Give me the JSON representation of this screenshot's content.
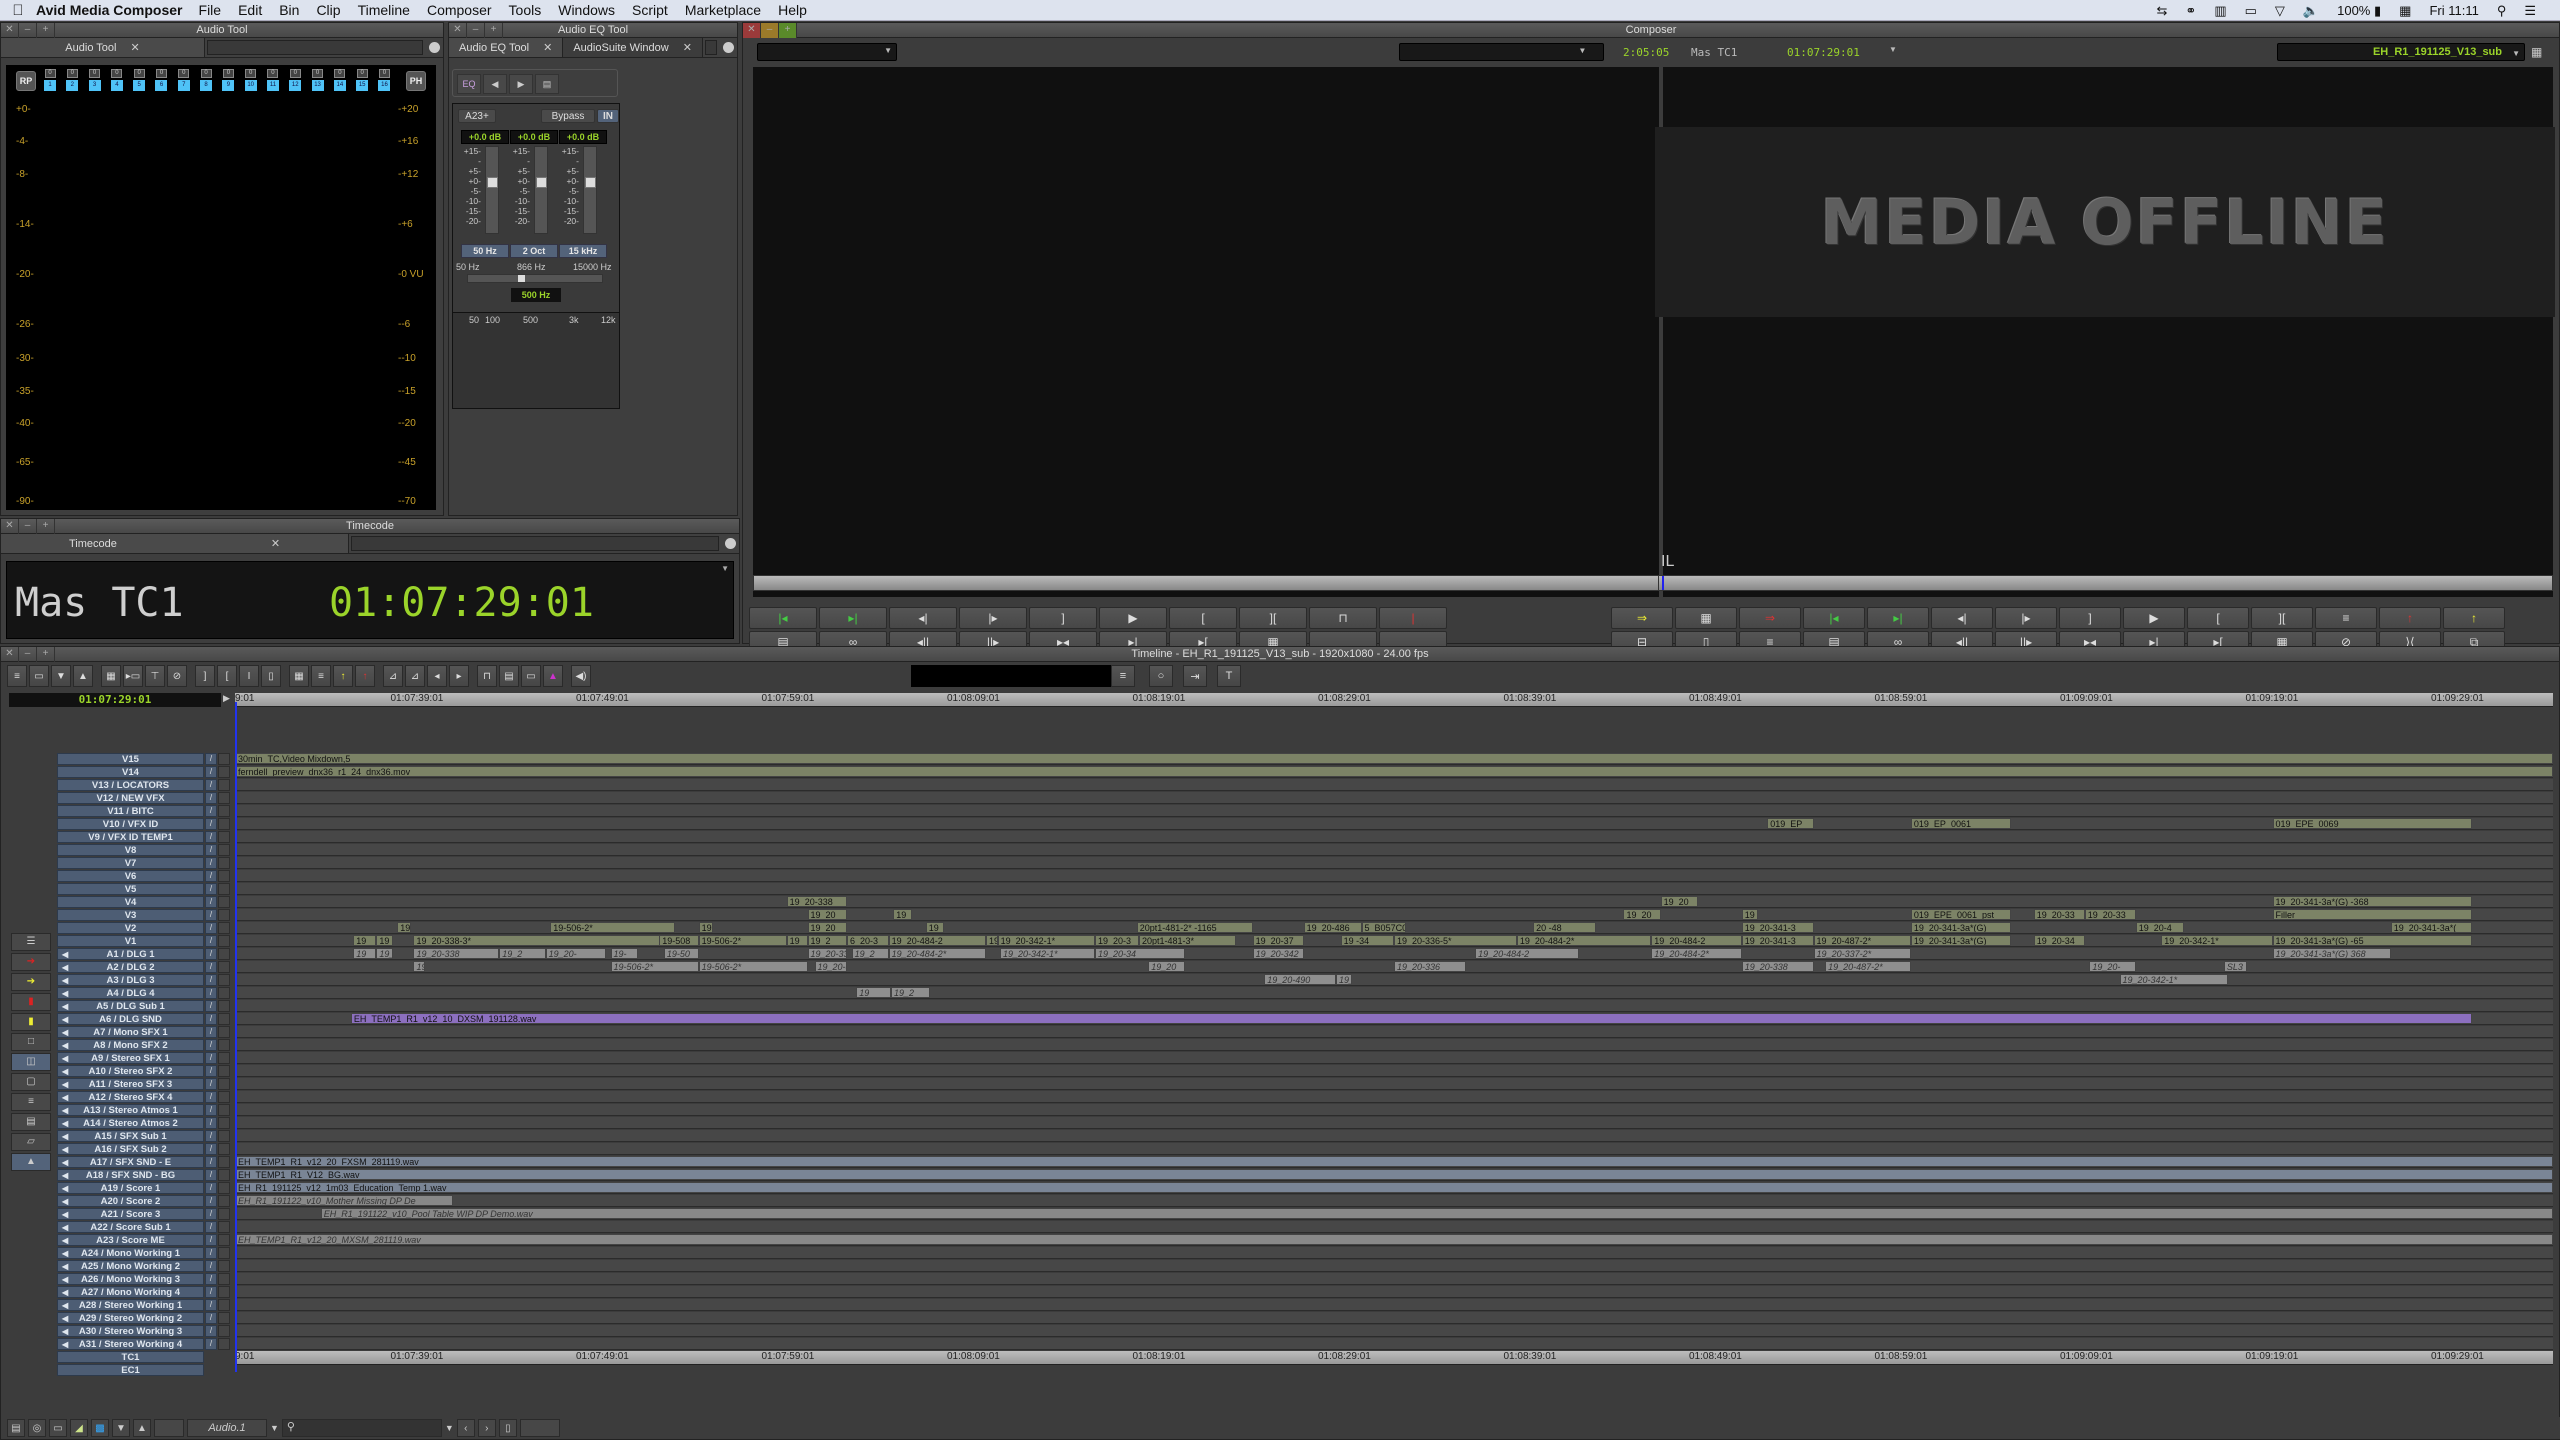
{
  "menubar": {
    "app_name": "Avid Media Composer",
    "items": [
      "File",
      "Edit",
      "Bin",
      "Clip",
      "Timeline",
      "Composer",
      "Tools",
      "Windows",
      "Script",
      "Marketplace",
      "Help"
    ],
    "status": {
      "battery": "100%",
      "clock": "Fri 11:11"
    }
  },
  "audio_tool": {
    "window_title": "Audio Tool",
    "tab_label": "Audio Tool",
    "rp_label": "RP",
    "ph_label": "PH",
    "channels": [
      "1",
      "2",
      "3",
      "4",
      "5",
      "6",
      "7",
      "8",
      "9",
      "10",
      "11",
      "12",
      "13",
      "14",
      "15",
      "16"
    ],
    "channel_peak": "0",
    "left_scale": [
      "+0-",
      "-4-",
      "-8-",
      "-14-",
      "-20-",
      "-26-",
      "-30-",
      "-35-",
      "-40-",
      "-65-",
      "-90-"
    ],
    "right_scale": [
      "-+20",
      "-+16",
      "-+12",
      "-+6",
      "-0 VU",
      "--6",
      "--10",
      "--15",
      "--20",
      "--45",
      "--70"
    ]
  },
  "eq_tool": {
    "window_title": "Audio EQ Tool",
    "tabs": [
      "Audio EQ Tool",
      "AudioSuite Window"
    ],
    "eq_icon_label": "EQ",
    "track_button": "A23+",
    "bypass_label": "Bypass",
    "in_label": "IN",
    "band_gains": [
      "+0.0 dB",
      "+0.0 dB",
      "+0.0 dB"
    ],
    "fader_scale": [
      "+15-",
      "-",
      "+5-",
      "+0-",
      "-5-",
      "-10-",
      "-15-",
      "-20-"
    ],
    "band_buttons": [
      "50 Hz",
      "2 Oct",
      "15 kHz"
    ],
    "freq_range": [
      "50 Hz",
      "866 Hz",
      "15000 Hz"
    ],
    "mid_freq": "500 Hz",
    "graph_labels": [
      "50",
      "100",
      "500",
      "3k",
      "12k"
    ]
  },
  "timecode_window": {
    "window_title": "Timecode",
    "tab_label": "Timecode",
    "label": "Mas TC1",
    "value": "01:07:29:01"
  },
  "composer": {
    "window_title": "Composer",
    "duration": "2:05:05",
    "tc_label": "Mas TC1",
    "tc_value": "01:07:29:01",
    "sequence_name": "EH_R1_191125_V13_sub",
    "offline_text": "MEDIA OFFLINE",
    "overlay_text": "IL"
  },
  "timeline": {
    "title": "Timeline - EH_R1_191125_V13_sub - 1920x1080 - 24.00 fps",
    "current_tc": "01:07:29:01",
    "ruler_ticks": [
      "9:01",
      "01:07:39:01",
      "01:07:49:01",
      "01:07:59:01",
      "01:08:09:01",
      "01:08:19:01",
      "01:08:29:01",
      "01:08:39:01",
      "01:08:49:01",
      "01:08:59:01",
      "01:09:09:01",
      "01:09:19:01",
      "01:09:29:01"
    ],
    "tracks": [
      {
        "name": "V15",
        "clips": [
          {
            "label": "30min_TC,Video Mixdown,5",
            "start": 0,
            "end": 1,
            "type": "v"
          }
        ]
      },
      {
        "name": "V14",
        "clips": [
          {
            "label": "ferndell_preview_dnx36_r1_24_dnx36.mov",
            "start": 0,
            "end": 1,
            "type": "v"
          }
        ]
      },
      {
        "name": "V13 / LOCATORS",
        "clips": []
      },
      {
        "name": "V12 / NEW VFX",
        "clips": []
      },
      {
        "name": "V11 / BITC",
        "clips": []
      },
      {
        "name": "V10 / VFX ID",
        "clips": [
          {
            "label": "019_EP",
            "start": 0.661,
            "end": 0.681,
            "type": "v"
          },
          {
            "label": "019_EP_0061",
            "start": 0.723,
            "end": 0.766,
            "type": "v"
          },
          {
            "label": "019_EPE_0069",
            "start": 0.879,
            "end": 0.965,
            "type": "v"
          }
        ]
      },
      {
        "name": "V9 / VFX ID TEMP1",
        "clips": []
      },
      {
        "name": "V8",
        "clips": []
      },
      {
        "name": "V7",
        "clips": []
      },
      {
        "name": "V6",
        "clips": []
      },
      {
        "name": "V5",
        "clips": []
      },
      {
        "name": "V4",
        "clips": [
          {
            "label": "19_20-338",
            "start": 0.238,
            "end": 0.264,
            "type": "v"
          },
          {
            "label": "19_20",
            "start": 0.615,
            "end": 0.631,
            "type": "v"
          },
          {
            "label": "19_20-341-3a*(G)  -368",
            "start": 0.879,
            "end": 0.965,
            "type": "v"
          }
        ]
      },
      {
        "name": "V3",
        "clips": [
          {
            "label": "19_20",
            "start": 0.247,
            "end": 0.264,
            "type": "v"
          },
          {
            "label": "19",
            "start": 0.284,
            "end": 0.292,
            "type": "v"
          },
          {
            "label": "19_20",
            "start": 0.599,
            "end": 0.615,
            "type": "v"
          },
          {
            "label": "19_",
            "start": 0.65,
            "end": 0.657,
            "type": "v"
          },
          {
            "label": "019_EPE_0061_pst",
            "start": 0.723,
            "end": 0.766,
            "type": "v"
          },
          {
            "label": "19_20-33",
            "start": 0.776,
            "end": 0.798,
            "type": "v"
          },
          {
            "label": "19_20-33",
            "start": 0.798,
            "end": 0.82,
            "type": "v"
          },
          {
            "label": "Filler",
            "start": 0.879,
            "end": 0.965,
            "type": "v"
          }
        ]
      },
      {
        "name": "V2",
        "clips": [
          {
            "label": "19",
            "start": 0.07,
            "end": 0.076,
            "type": "v"
          },
          {
            "label": "19-506-2*",
            "start": 0.136,
            "end": 0.19,
            "type": "v"
          },
          {
            "label": "19",
            "start": 0.2,
            "end": 0.206,
            "type": "v"
          },
          {
            "label": "19_20",
            "start": 0.247,
            "end": 0.264,
            "type": "v"
          },
          {
            "label": "19",
            "start": 0.298,
            "end": 0.306,
            "type": "v"
          },
          {
            "label": "20pt1-481-2*  -1165",
            "start": 0.389,
            "end": 0.439,
            "type": "v"
          },
          {
            "label": "19_20-486",
            "start": 0.461,
            "end": 0.486,
            "type": "v"
          },
          {
            "label": "5_B057C0",
            "start": 0.486,
            "end": 0.505,
            "type": "v"
          },
          {
            "label": "20  -48",
            "start": 0.56,
            "end": 0.587,
            "type": "v"
          },
          {
            "label": "19_20-341-3",
            "start": 0.65,
            "end": 0.681,
            "type": "v"
          },
          {
            "label": "19_20-341-3a*(G)",
            "start": 0.723,
            "end": 0.766,
            "type": "v"
          },
          {
            "label": "19_20-4",
            "start": 0.82,
            "end": 0.841,
            "type": "v"
          },
          {
            "label": "19_20-341-3a*(",
            "start": 0.93,
            "end": 0.965,
            "type": "v"
          }
        ]
      },
      {
        "name": "V1",
        "clips": [
          {
            "label": "19",
            "start": 0.051,
            "end": 0.061,
            "type": "v"
          },
          {
            "label": "19",
            "start": 0.061,
            "end": 0.068,
            "type": "v"
          },
          {
            "label": "19_20-338-3*",
            "start": 0.077,
            "end": 0.191,
            "type": "v"
          },
          {
            "label": "19-508",
            "start": 0.183,
            "end": 0.2,
            "type": "v"
          },
          {
            "label": "19-506-2*",
            "start": 0.2,
            "end": 0.238,
            "type": "v"
          },
          {
            "label": "19_",
            "start": 0.238,
            "end": 0.247,
            "type": "v"
          },
          {
            "label": "19_2",
            "start": 0.247,
            "end": 0.264,
            "type": "v"
          },
          {
            "label": "6_20-3",
            "start": 0.264,
            "end": 0.282,
            "type": "v"
          },
          {
            "label": "19_20-484-2",
            "start": 0.282,
            "end": 0.324,
            "type": "v"
          },
          {
            "label": "19",
            "start": 0.324,
            "end": 0.329,
            "type": "v"
          },
          {
            "label": "19_20-342-1*",
            "start": 0.329,
            "end": 0.371,
            "type": "v"
          },
          {
            "label": "19_20-3",
            "start": 0.371,
            "end": 0.39,
            "type": "v"
          },
          {
            "label": "20pt1-481-3*",
            "start": 0.39,
            "end": 0.432,
            "type": "v"
          },
          {
            "label": "19_20-37",
            "start": 0.439,
            "end": 0.461,
            "type": "v"
          },
          {
            "label": "19  -34",
            "start": 0.477,
            "end": 0.5,
            "type": "v"
          },
          {
            "label": "19_20-336-5*",
            "start": 0.5,
            "end": 0.553,
            "type": "v"
          },
          {
            "label": "19_20-484-2*",
            "start": 0.553,
            "end": 0.611,
            "type": "v"
          },
          {
            "label": "19_20-484-2",
            "start": 0.611,
            "end": 0.65,
            "type": "v"
          },
          {
            "label": "19_20-341-3",
            "start": 0.65,
            "end": 0.681,
            "type": "v"
          },
          {
            "label": "19_20-487-2*",
            "start": 0.681,
            "end": 0.723,
            "type": "v"
          },
          {
            "label": "19_20-341-3a*(G)",
            "start": 0.723,
            "end": 0.766,
            "type": "v"
          },
          {
            "label": "19_20-34",
            "start": 0.776,
            "end": 0.798,
            "type": "v"
          },
          {
            "label": "19_20-342-1*",
            "start": 0.831,
            "end": 0.879,
            "type": "v"
          },
          {
            "label": "19_20-341-3a*(G)  -65",
            "start": 0.879,
            "end": 0.965,
            "type": "v"
          }
        ]
      },
      {
        "name": "A1 / DLG 1",
        "clips": [
          {
            "label": "19",
            "start": 0.051,
            "end": 0.061,
            "type": "a"
          },
          {
            "label": "19_",
            "start": 0.061,
            "end": 0.068,
            "type": "a"
          },
          {
            "label": "19_20-338",
            "start": 0.077,
            "end": 0.114,
            "type": "a"
          },
          {
            "label": "19_2",
            "start": 0.114,
            "end": 0.134,
            "type": "a"
          },
          {
            "label": "19_20-",
            "start": 0.134,
            "end": 0.16,
            "type": "a"
          },
          {
            "label": "19-",
            "start": 0.162,
            "end": 0.174,
            "type": "a"
          },
          {
            "label": "19-50",
            "start": 0.185,
            "end": 0.2,
            "type": "a"
          },
          {
            "label": "19_20-33",
            "start": 0.247,
            "end": 0.264,
            "type": "a"
          },
          {
            "label": "19_2",
            "start": 0.266,
            "end": 0.282,
            "type": "a"
          },
          {
            "label": "19_20-484-2*",
            "start": 0.282,
            "end": 0.324,
            "type": "a"
          },
          {
            "label": "19_20-342-1*",
            "start": 0.33,
            "end": 0.371,
            "type": "a"
          },
          {
            "label": "19_20-34",
            "start": 0.371,
            "end": 0.41,
            "type": "a"
          },
          {
            "label": "19_20-342",
            "start": 0.439,
            "end": 0.461,
            "type": "a"
          },
          {
            "label": "19_20-484-2",
            "start": 0.535,
            "end": 0.58,
            "type": "a"
          },
          {
            "label": "19_20-484-2*",
            "start": 0.611,
            "end": 0.65,
            "type": "a"
          },
          {
            "label": "19_20-337-2*",
            "start": 0.681,
            "end": 0.723,
            "type": "a"
          },
          {
            "label": "19_20-341-3a*(G)  368",
            "start": 0.879,
            "end": 0.93,
            "type": "a"
          }
        ]
      },
      {
        "name": "A2 / DLG 2",
        "clips": [
          {
            "label": "19",
            "start": 0.077,
            "end": 0.082,
            "type": "a"
          },
          {
            "label": "19-506-2*",
            "start": 0.162,
            "end": 0.2,
            "type": "a"
          },
          {
            "label": "19-506-2*",
            "start": 0.2,
            "end": 0.247,
            "type": "a"
          },
          {
            "label": "19_20-3",
            "start": 0.25,
            "end": 0.264,
            "type": "a"
          },
          {
            "label": "19_20",
            "start": 0.394,
            "end": 0.41,
            "type": "a"
          },
          {
            "label": "19_20-336",
            "start": 0.5,
            "end": 0.531,
            "type": "a"
          },
          {
            "label": "19_20-338",
            "start": 0.65,
            "end": 0.681,
            "type": "a"
          },
          {
            "label": "19_20-487-2*",
            "start": 0.686,
            "end": 0.723,
            "type": "a"
          },
          {
            "label": "19_20-",
            "start": 0.8,
            "end": 0.82,
            "type": "a"
          },
          {
            "label": "SL3",
            "start": 0.858,
            "end": 0.868,
            "type": "a"
          }
        ]
      },
      {
        "name": "A3 / DLG 3",
        "clips": [
          {
            "label": "19_20-490",
            "start": 0.444,
            "end": 0.475,
            "type": "a"
          },
          {
            "label": "19_",
            "start": 0.475,
            "end": 0.482,
            "type": "a"
          },
          {
            "label": "19_20-342-1*",
            "start": 0.813,
            "end": 0.86,
            "type": "a"
          }
        ]
      },
      {
        "name": "A4 / DLG 4",
        "clips": [
          {
            "label": "19",
            "start": 0.268,
            "end": 0.283,
            "type": "a"
          },
          {
            "label": "19_2",
            "start": 0.283,
            "end": 0.3,
            "type": "a"
          }
        ]
      },
      {
        "name": "A5 / DLG Sub 1",
        "clips": []
      },
      {
        "name": "A6 / DLG SND",
        "clips": [
          {
            "label": "EH_TEMP1_R1_v12_10_DXSM_191128.wav",
            "start": 0.05,
            "end": 0.965,
            "type": "p"
          }
        ]
      },
      {
        "name": "A7 / Mono SFX 1",
        "clips": []
      },
      {
        "name": "A8 / Mono SFX 2",
        "clips": []
      },
      {
        "name": "A9 / Stereo SFX 1",
        "clips": []
      },
      {
        "name": "A10 / Stereo SFX 2",
        "clips": []
      },
      {
        "name": "A11 / Stereo SFX 3",
        "clips": []
      },
      {
        "name": "A12 / Stereo SFX 4",
        "clips": []
      },
      {
        "name": "A13 / Stereo Atmos 1",
        "clips": []
      },
      {
        "name": "A14 / Stereo Atmos 2",
        "clips": []
      },
      {
        "name": "A15 / SFX Sub 1",
        "clips": []
      },
      {
        "name": "A16 / SFX Sub 2",
        "clips": []
      },
      {
        "name": "A17 / SFX SND - E",
        "clips": [
          {
            "label": "EH_TEMP1_R1_v12_20_FXSM_281119.wav",
            "start": 0,
            "end": 1,
            "type": "b"
          }
        ]
      },
      {
        "name": "A18 / SFX SND - BG",
        "clips": [
          {
            "label": "EH_TEMP1_R1_V12_BG.wav",
            "start": 0,
            "end": 1,
            "type": "b"
          }
        ]
      },
      {
        "name": "A19 / Score 1",
        "clips": [
          {
            "label": "EH_R1_191125_v12_1m03_Education_Temp 1.wav",
            "start": 0,
            "end": 1,
            "type": "b"
          }
        ]
      },
      {
        "name": "A20 / Score 2",
        "clips": [
          {
            "label": "EH_R1_191122_v10_Mother Missing DP De",
            "start": 0,
            "end": 0.094,
            "type": "g"
          }
        ]
      },
      {
        "name": "A21 / Score 3",
        "clips": [
          {
            "label": "EH_R1_191122_v10_Pool Table WIP DP Demo.wav",
            "start": 0.037,
            "end": 1,
            "type": "g"
          }
        ]
      },
      {
        "name": "A22 / Score Sub 1",
        "clips": []
      },
      {
        "name": "A23 / Score ME",
        "clips": [
          {
            "label": "EH_TEMP1_R1_v12_20_MXSM_281119.wav",
            "start": 0,
            "end": 1,
            "type": "g"
          }
        ]
      },
      {
        "name": "A24 / Mono Working 1",
        "clips": []
      },
      {
        "name": "A25 / Mono Working 2",
        "clips": []
      },
      {
        "name": "A26 / Mono Working 3",
        "clips": []
      },
      {
        "name": "A27 / Mono Working 4",
        "clips": []
      },
      {
        "name": "A28 / Stereo Working 1",
        "clips": []
      },
      {
        "name": "A29 / Stereo Working 2",
        "clips": []
      },
      {
        "name": "A30 / Stereo Working 3",
        "clips": []
      },
      {
        "name": "A31 / Stereo Working 4",
        "clips": []
      }
    ],
    "bottom": {
      "track_selector": "Audio.1",
      "search_placeholder": ""
    }
  }
}
